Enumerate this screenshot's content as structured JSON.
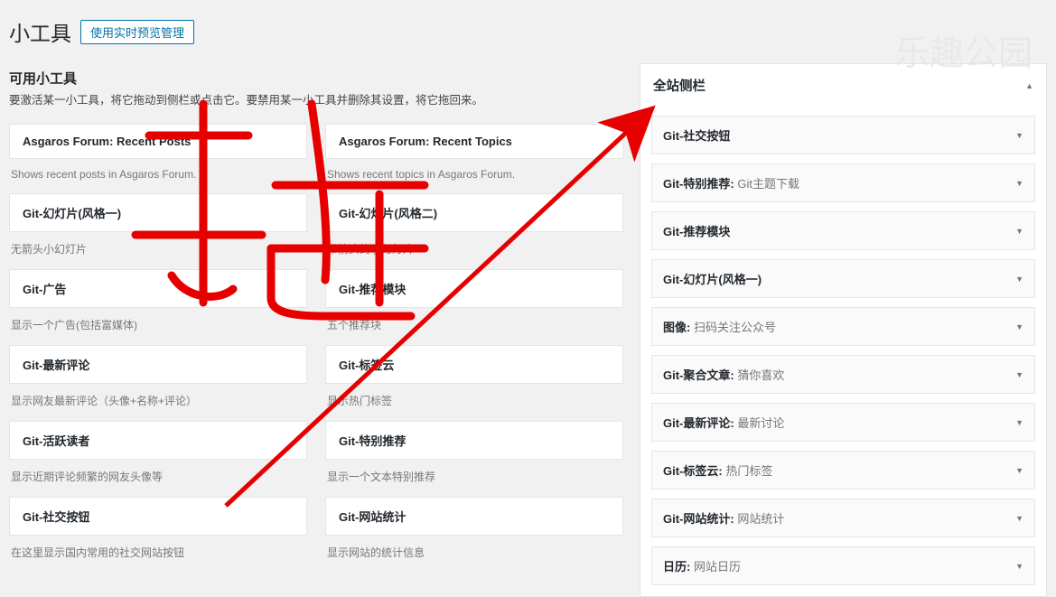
{
  "watermark": "乐趣公园",
  "page_title": "小工具",
  "preview_button": "使用实时预览管理",
  "available": {
    "heading": "可用小工具",
    "desc": "要激活某一小工具，将它拖动到侧栏或点击它。要禁用某一小工具并删除其设置，将它拖回来。"
  },
  "left_widgets": [
    {
      "title": "Asgaros Forum: Recent Posts",
      "desc": "Shows recent posts in Asgaros Forum."
    },
    {
      "title": "Asgaros Forum: Recent Topics",
      "desc": "Shows recent topics in Asgaros Forum."
    },
    {
      "title": "Git-幻灯片(风格一)",
      "desc": "无箭头小幻灯片"
    },
    {
      "title": "Git-幻灯片(风格二)",
      "desc": "带箭头的小幻灯片"
    },
    {
      "title": "Git-广告",
      "desc": "显示一个广告(包括富媒体)"
    },
    {
      "title": "Git-推荐模块",
      "desc": "五个推荐块"
    },
    {
      "title": "Git-最新评论",
      "desc": "显示网友最新评论（头像+名称+评论）"
    },
    {
      "title": "Git-标签云",
      "desc": "显示热门标签"
    },
    {
      "title": "Git-活跃读者",
      "desc": "显示近期评论频繁的网友头像等"
    },
    {
      "title": "Git-特别推荐",
      "desc": "显示一个文本特别推荐"
    },
    {
      "title": "Git-社交按钮",
      "desc": "在这里显示国内常用的社交网站按钮"
    },
    {
      "title": "Git-网站统计",
      "desc": "显示网站的统计信息"
    }
  ],
  "sidebar_area": {
    "title": "全站侧栏",
    "widgets": [
      {
        "name": "Git-社交按钮",
        "sub": ""
      },
      {
        "name": "Git-特别推荐",
        "sub": "Git主题下载"
      },
      {
        "name": "Git-推荐模块",
        "sub": ""
      },
      {
        "name": "Git-幻灯片(风格一)",
        "sub": ""
      },
      {
        "name": "图像",
        "sub": "扫码关注公众号"
      },
      {
        "name": "Git-聚合文章",
        "sub": "猜你喜欢"
      },
      {
        "name": "Git-最新评论",
        "sub": "最新讨论"
      },
      {
        "name": "Git-标签云",
        "sub": "热门标签"
      },
      {
        "name": "Git-网站统计",
        "sub": "网站统计"
      },
      {
        "name": "日历",
        "sub": "网站日历"
      }
    ]
  }
}
